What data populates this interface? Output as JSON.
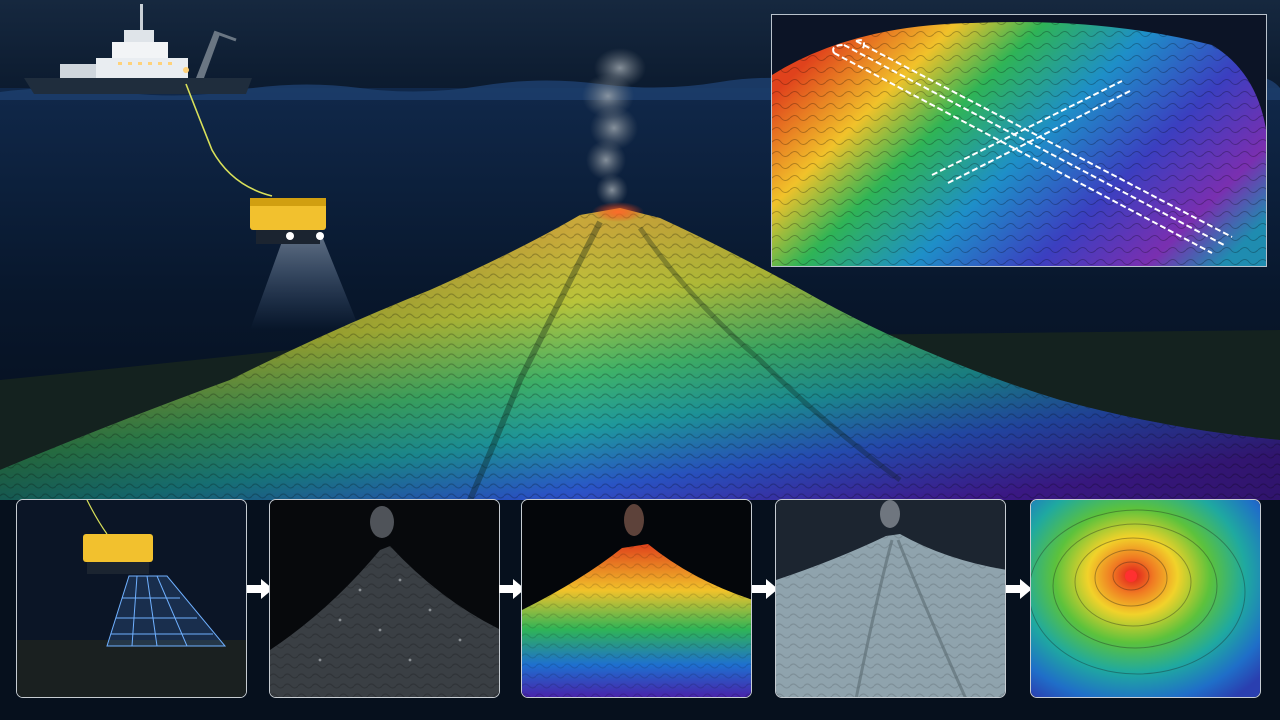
{
  "scene": {
    "palette": {
      "sky": "#0b1a2e",
      "ocean": "#0a1a33",
      "ship_hull": "#1f2d3d",
      "rov_body": "#f2c12e",
      "sediment": "#1d2b2e",
      "bathy_low": "#3b1fa8",
      "bathy_mid": "#1fb56a",
      "bathy_high": "#e0421c",
      "frame_border": "#c6ccd2"
    }
  },
  "workflow": {
    "steps": [
      {
        "name": "rov-multibeam-scan"
      },
      {
        "name": "grayscale-point-cloud"
      },
      {
        "name": "depth-colored-point-cloud"
      },
      {
        "name": "shaded-terrain-mesh"
      },
      {
        "name": "bathymetric-contour-map"
      }
    ]
  }
}
